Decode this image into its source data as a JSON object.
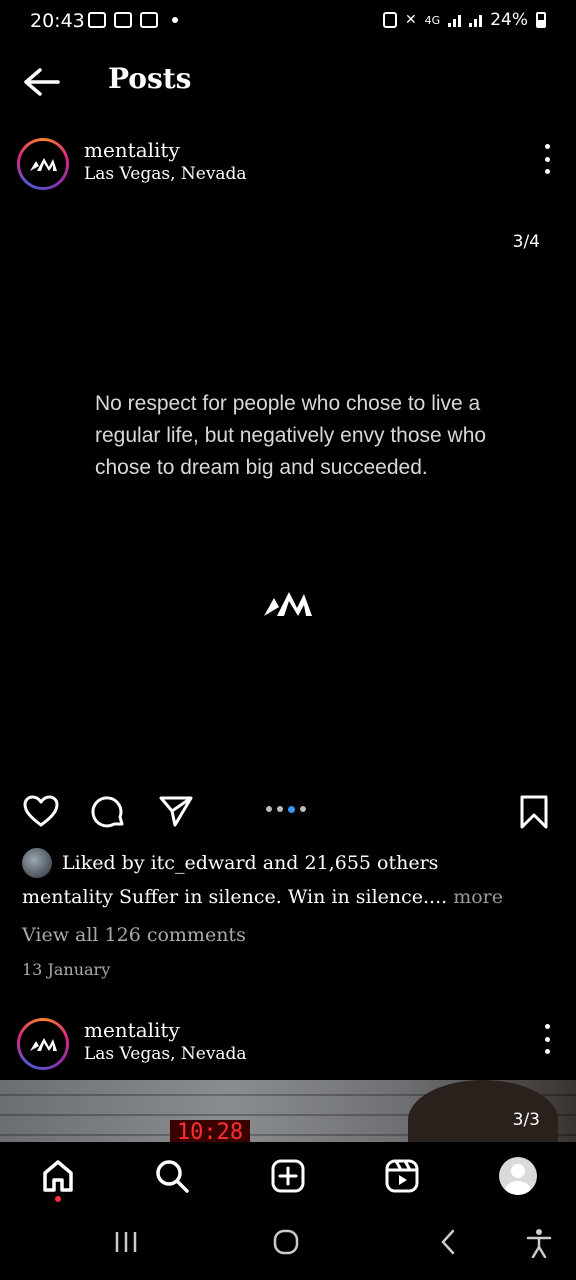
{
  "status_bar": {
    "time": "20:43",
    "network": "4G",
    "battery": "24%"
  },
  "header": {
    "title": "Posts"
  },
  "post": {
    "username": "mentality",
    "location": "Las Vegas, Nevada",
    "slide_counter": "3/4",
    "quote": "No respect for people who chose to live a regular life, but negatively envy those who chose to dream big and succeeded.",
    "liked_by_prefix": "Liked by ",
    "liked_by_user": "itc_edward",
    "liked_by_suffix": " and 21,655 others",
    "caption_user": "mentality",
    "caption_text": " Suffer in silence. Win in silence.... ",
    "caption_more": "more",
    "view_comments": "View all 126 comments",
    "date": "13 January"
  },
  "next_post": {
    "username": "mentality",
    "location": "Las Vegas, Nevada",
    "slide_counter": "3/3",
    "clock_text": "10:28"
  },
  "colors": {
    "background": "#000000",
    "active_dot": "#3897f0",
    "notification_dot": "#ff3040"
  },
  "icons": {
    "back": "arrow-left-icon",
    "more": "more-vertical-icon",
    "like": "heart-icon",
    "comment": "comment-icon",
    "share": "send-icon",
    "save": "bookmark-icon",
    "home": "home-icon",
    "search": "search-icon",
    "create": "plus-square-icon",
    "reels": "reels-icon"
  }
}
